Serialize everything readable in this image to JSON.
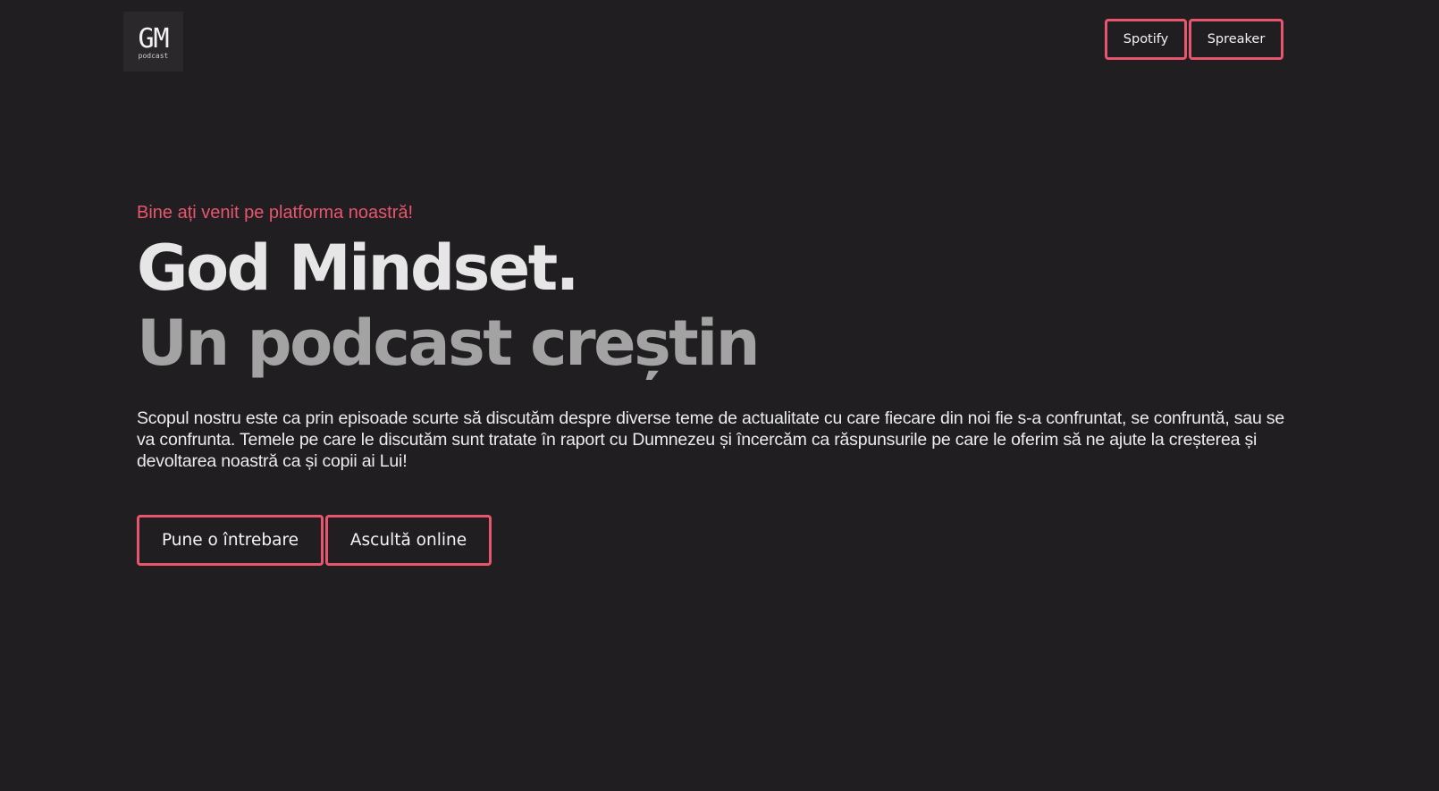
{
  "header": {
    "logo": {
      "mark": "GM",
      "subtitle": "podcast"
    },
    "nav": [
      {
        "label": "Spotify"
      },
      {
        "label": "Spreaker"
      }
    ]
  },
  "hero": {
    "eyebrow": "Bine ați venit pe platforma noastră!",
    "title_line1": "God Mindset.",
    "title_line2": "Un podcast creștin",
    "description": "Scopul nostru este ca prin episoade scurte să discutăm despre diverse teme de actualitate cu care fiecare din noi fie s-a confruntat, se confruntă, sau se va confrunta. Temele pe care le discutăm sunt tratate în raport cu Dumnezeu și încercăm ca răspunsurile pe care le oferim să ne ajute la creșterea și devoltarea noastră ca și copii ai Lui!",
    "buttons": [
      {
        "label": "Pune o întrebare"
      },
      {
        "label": "Ascultă online"
      }
    ]
  },
  "colors": {
    "background": "#201e21",
    "accent": "#e8566e",
    "title_primary": "#e6e6e6",
    "title_secondary": "#a3a3a3"
  }
}
